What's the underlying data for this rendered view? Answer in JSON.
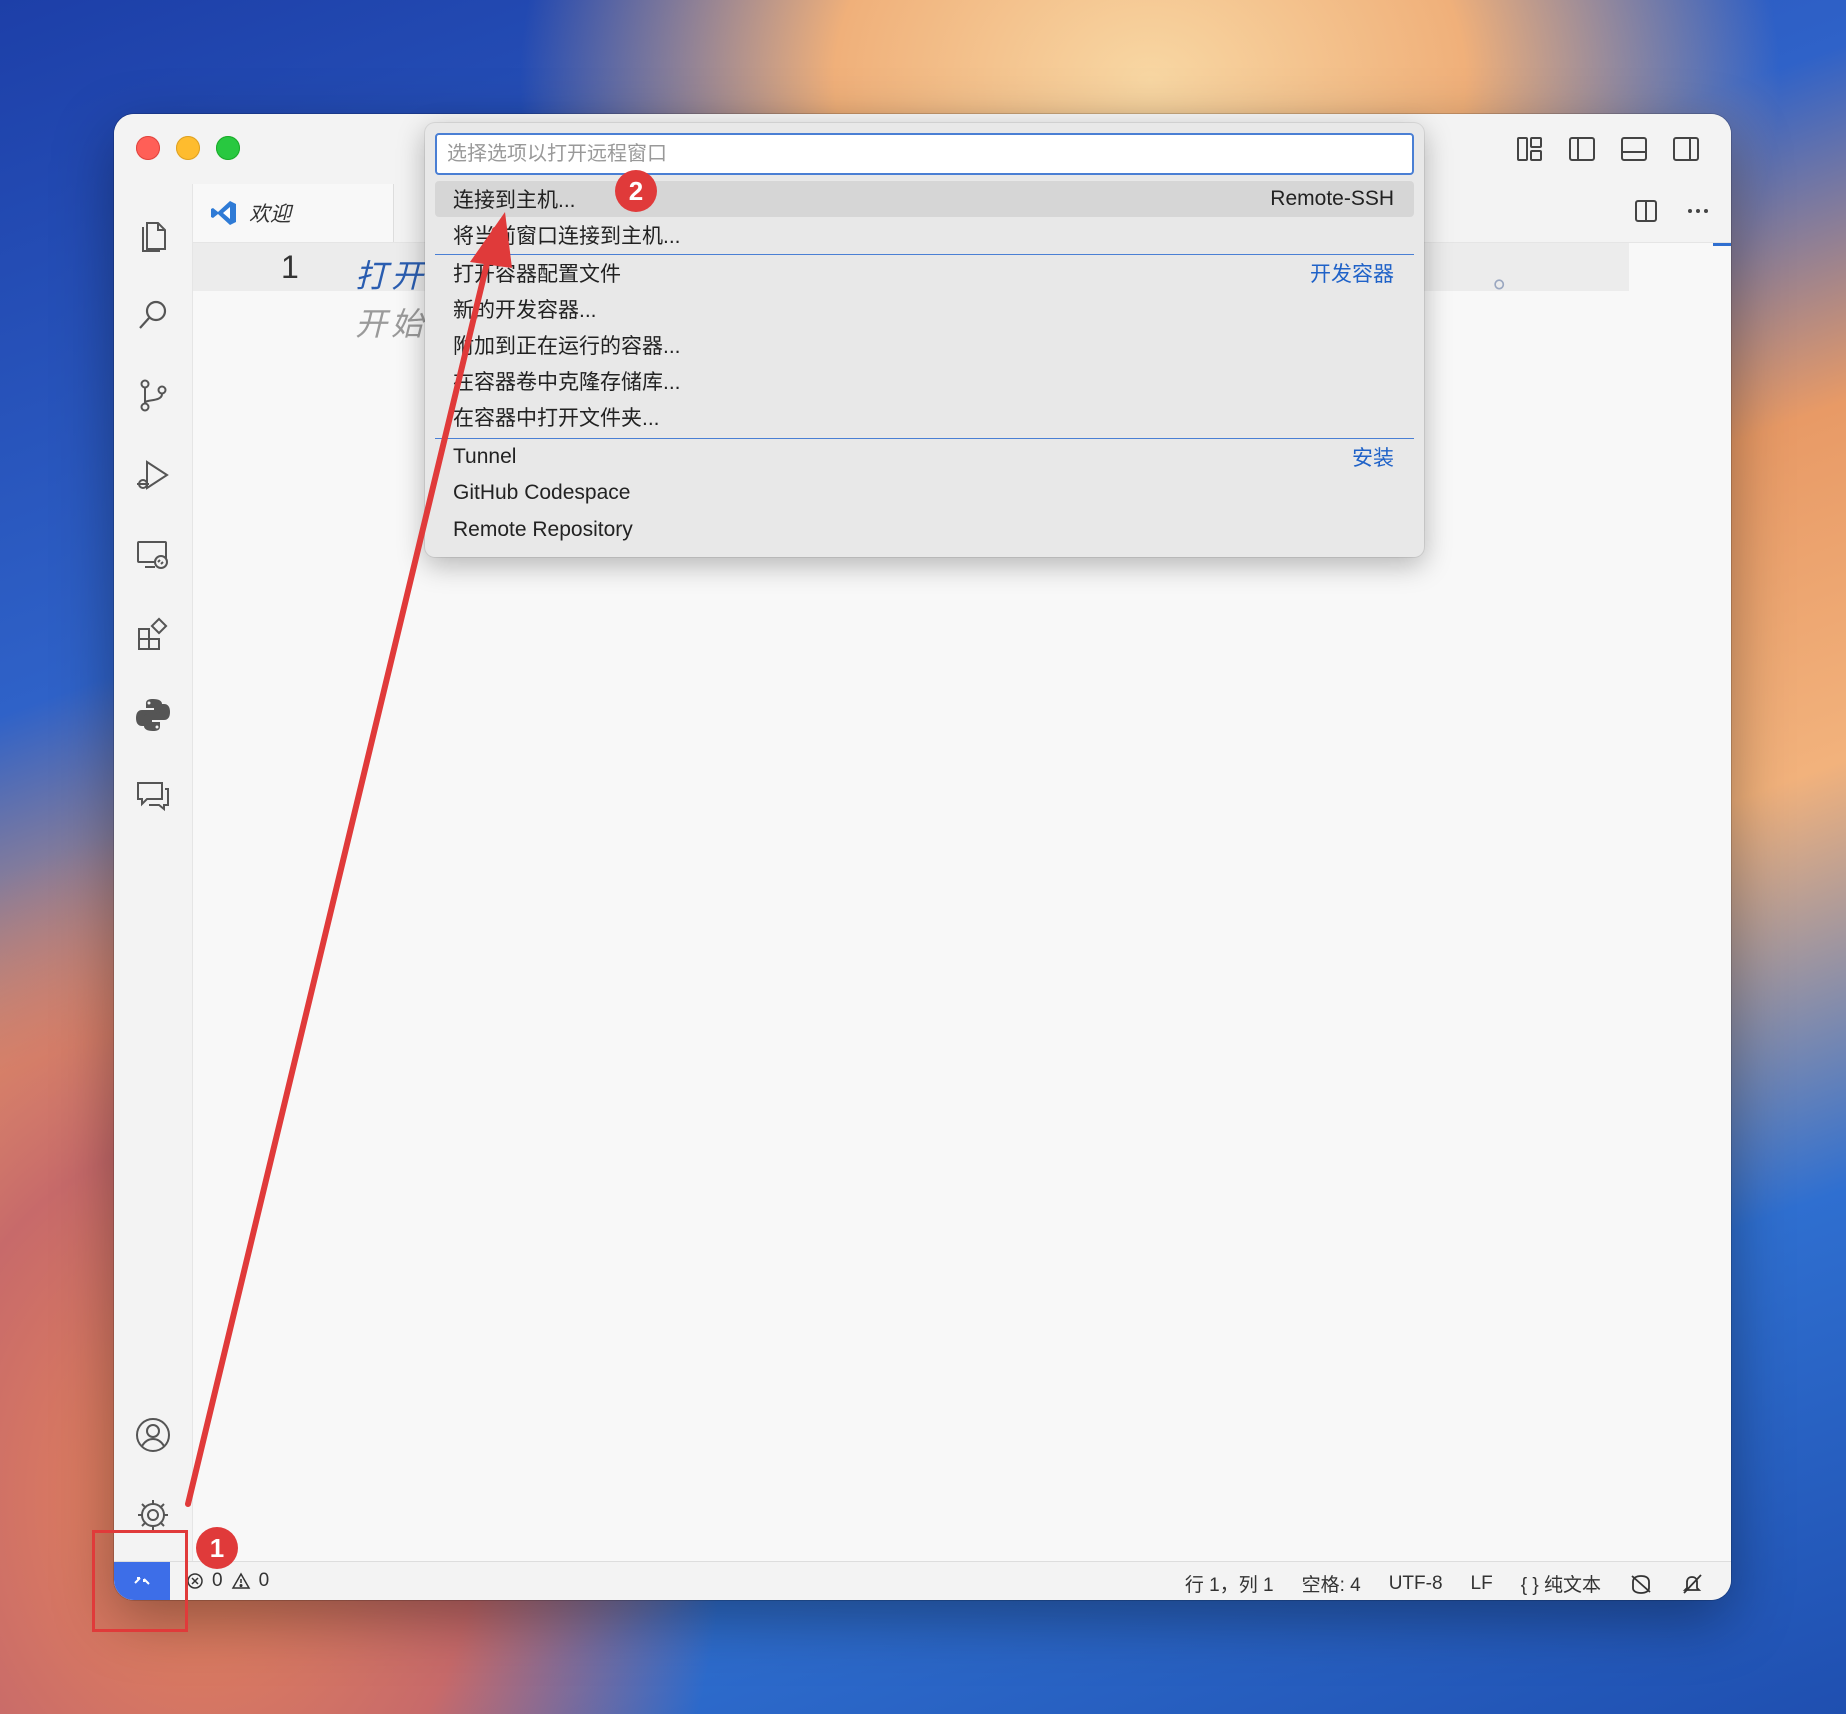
{
  "tabs": {
    "welcome_label": "欢迎"
  },
  "editor": {
    "line_number": "1",
    "line1_text": "打开",
    "line1_tail": "。",
    "line2_text": "开始"
  },
  "quick_pick": {
    "placeholder": "选择选项以打开远程窗口",
    "groups": [
      {
        "items": [
          {
            "label": "连接到主机...",
            "tag": "Remote-SSH"
          },
          {
            "label": "将当前窗口连接到主机...",
            "tag": ""
          }
        ]
      },
      {
        "items": [
          {
            "label": "打开容器配置文件",
            "tag": "开发容器"
          },
          {
            "label": "新的开发容器...",
            "tag": ""
          },
          {
            "label": "附加到正在运行的容器...",
            "tag": ""
          },
          {
            "label": "在容器卷中克隆存储库...",
            "tag": ""
          },
          {
            "label": "在容器中打开文件夹...",
            "tag": ""
          }
        ]
      },
      {
        "items": [
          {
            "label": "Tunnel",
            "tag": "安装"
          },
          {
            "label": "GitHub Codespace",
            "tag": ""
          },
          {
            "label": "Remote Repository",
            "tag": ""
          }
        ]
      }
    ]
  },
  "status_bar": {
    "errors": "0",
    "warnings": "0",
    "position": "行 1，列 1",
    "spaces": "空格: 4",
    "encoding": "UTF-8",
    "eol": "LF",
    "language": "纯文本"
  },
  "annotations": {
    "step1": "1",
    "step2": "2"
  },
  "colors": {
    "accent": "#3d6ee8",
    "annotation": "#e03a3a",
    "link": "#1f62c8"
  }
}
